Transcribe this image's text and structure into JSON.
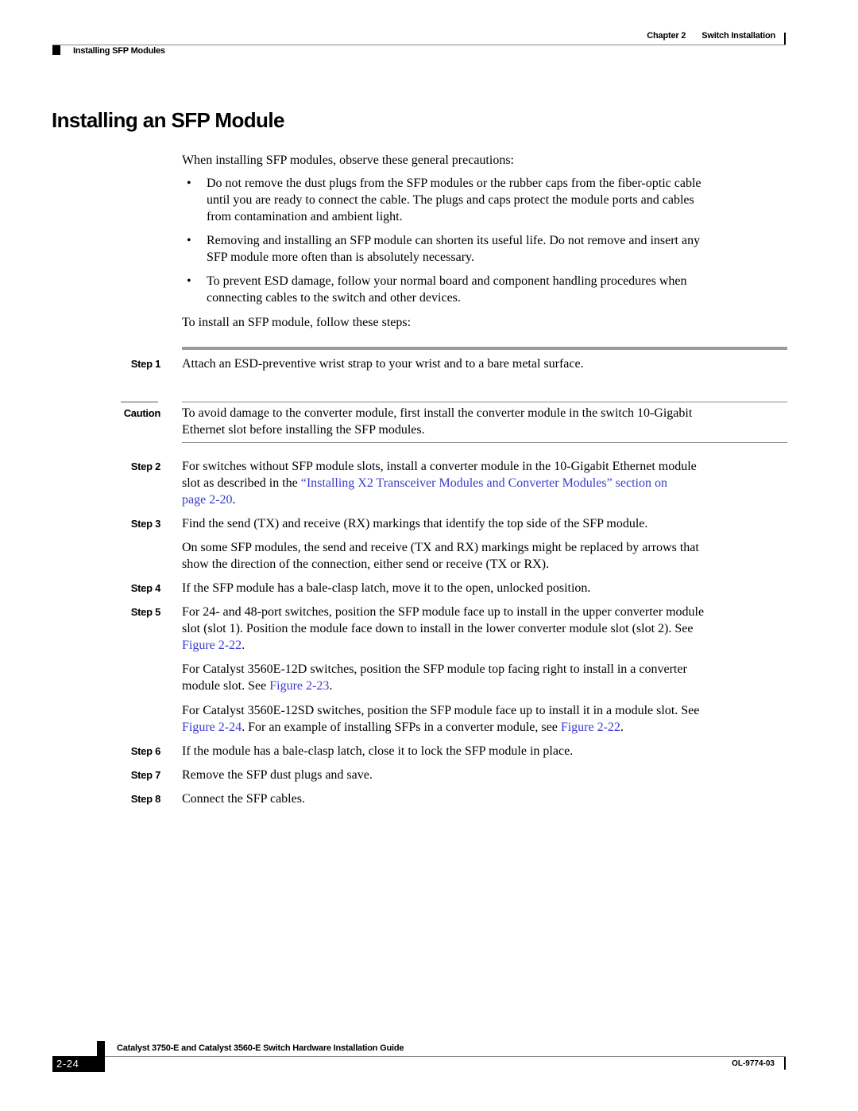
{
  "header": {
    "chapter_label": "Chapter 2",
    "chapter_title": "Switch Installation",
    "section": "Installing SFP Modules"
  },
  "title": "Installing an SFP Module",
  "intro": "When installing SFP modules, observe these general precautions:",
  "precautions": [
    {
      "lines": [
        "Do not remove the dust plugs from the SFP modules or the rubber caps from the fiber-optic cable",
        "until you are ready to connect the cable. The plugs and caps protect the module ports and cables",
        "from contamination and ambient light."
      ]
    },
    {
      "lines": [
        "Removing and installing an SFP module can shorten its useful life. Do not remove and insert any",
        "SFP module more often than is absolutely necessary."
      ]
    },
    {
      "lines": [
        "To prevent ESD damage, follow your normal board and component handling procedures when",
        "connecting cables to the switch and other devices."
      ]
    }
  ],
  "bullet_char": "•",
  "steps_intro": "To install an SFP module, follow these steps:",
  "steps": {
    "s1": {
      "label": "Step 1",
      "text": "Attach an ESD-preventive wrist strap to your wrist and to a bare metal surface."
    },
    "caution": {
      "label": "Caution",
      "line1": "To avoid damage to the converter module, first install the converter module in the switch 10-Gigabit",
      "line2": "Ethernet slot before installing the SFP modules."
    },
    "s2": {
      "label": "Step 2",
      "line1": "For switches without SFP module slots, install a converter module in the 10-Gigabit Ethernet module",
      "line2_prefix": "slot as described in the ",
      "link_part1": "“Installing X2 Transceiver Modules and Converter Modules” section on",
      "link_part2": "page 2-20",
      "line3_suffix": "."
    },
    "s3": {
      "label": "Step 3",
      "text": "Find the send (TX) and receive (RX) markings that identify the top side of the SFP module.",
      "note_line1": "On some SFP modules, the send and receive (TX and RX) markings might be replaced by arrows that",
      "note_line2": "show the direction of the connection, either send or receive (TX or RX)."
    },
    "s4": {
      "label": "Step 4",
      "text": "If the SFP module has a bale-clasp latch, move it to the open, unlocked position."
    },
    "s5": {
      "label": "Step 5",
      "line1": "For 24- and 48-port switches, position the SFP module face up to install in the upper converter module",
      "line2": "slot (slot 1). Position the module face down to install in the lower converter module slot (slot 2). See",
      "link": "Figure 2-22",
      "line3_suffix": ".",
      "p2_line1": "For Catalyst 3560E-12D switches, position the SFP module top facing right to install in a converter",
      "p2_line2_prefix": "module slot. See ",
      "p2_link": "Figure 2-23",
      "p2_suffix": ".",
      "p3_line1": "For Catalyst 3560E-12SD switches, position the SFP module face up to install it in a module slot. See",
      "p3_link1": "Figure 2-24",
      "p3_mid": ". For an example of installing SFPs in a converter module, see ",
      "p3_link2": "Figure 2-22",
      "p3_suffix": "."
    },
    "s6": {
      "label": "Step 6",
      "text": "If the module has a bale-clasp latch, close it to lock the SFP module in place."
    },
    "s7": {
      "label": "Step 7",
      "text": "Remove the SFP dust plugs and save."
    },
    "s8": {
      "label": "Step 8",
      "text": "Connect the SFP cables."
    }
  },
  "footer": {
    "guide_title": "Catalyst 3750-E and Catalyst 3560-E Switch Hardware Installation Guide",
    "page_number": "2-24",
    "doc_number": "OL-9774-03"
  },
  "colors": {
    "link": "#3a3acc",
    "rule": "#8a8a8a"
  }
}
